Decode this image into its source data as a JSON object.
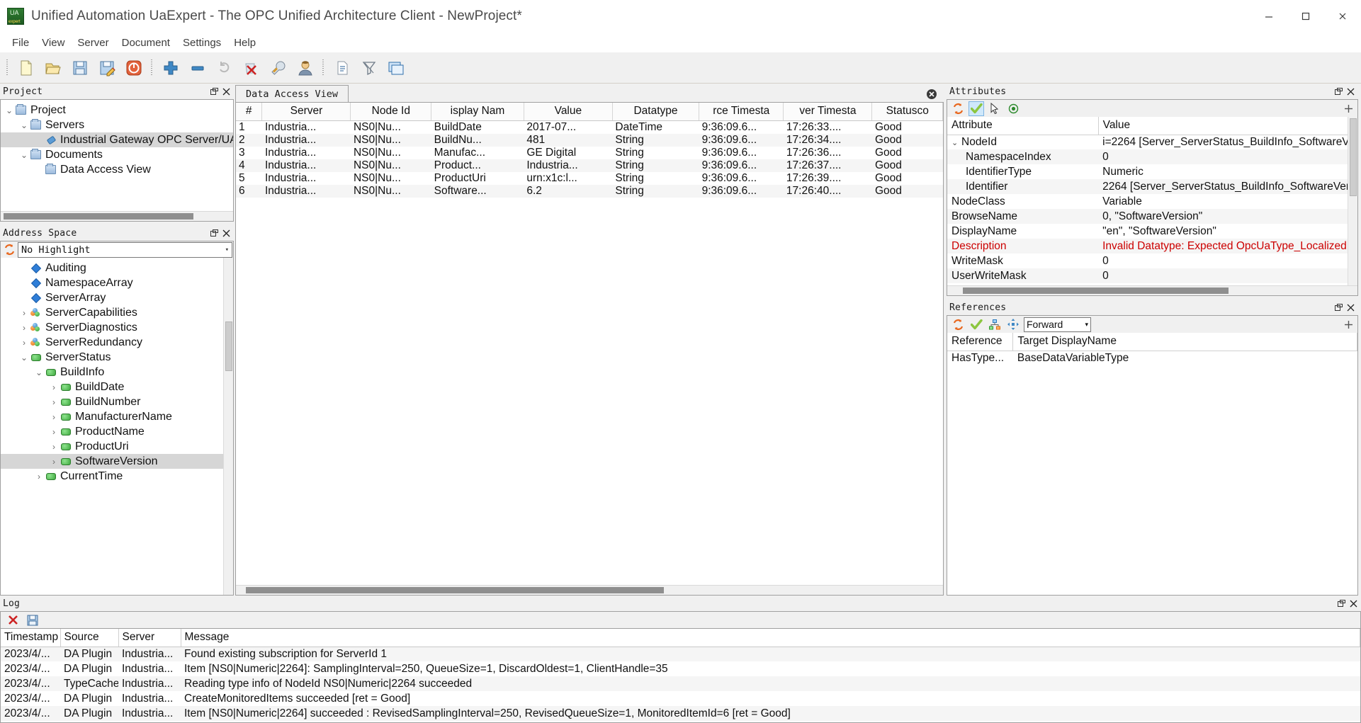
{
  "window": {
    "title": "Unified Automation UaExpert - The OPC Unified Architecture Client - NewProject*",
    "app_icon": "uaexpert-logo-icon",
    "minimize": "minimize-icon",
    "maximize": "maximize-icon",
    "close": "close-icon"
  },
  "menu": {
    "items": [
      "File",
      "View",
      "Server",
      "Document",
      "Settings",
      "Help"
    ]
  },
  "toolbar": {
    "groups": [
      [
        {
          "name": "new-project-icon",
          "tip": "New"
        },
        {
          "name": "open-project-icon",
          "tip": "Open"
        },
        {
          "name": "save-project-icon",
          "tip": "Save"
        },
        {
          "name": "save-as-project-icon",
          "tip": "Save As"
        },
        {
          "name": "disconnect-power-icon",
          "tip": "Disconnect"
        }
      ],
      [
        {
          "name": "add-server-icon",
          "tip": "Add Server"
        },
        {
          "name": "remove-server-icon",
          "tip": "Remove Server"
        },
        {
          "name": "reconnect-icon",
          "tip": "Reconnect"
        },
        {
          "name": "delete-red-x-icon",
          "tip": "Delete"
        },
        {
          "name": "configure-wrench-icon",
          "tip": "Configure"
        },
        {
          "name": "user-identity-icon",
          "tip": "User"
        }
      ],
      [
        {
          "name": "document-new-icon",
          "tip": "New Document"
        },
        {
          "name": "document-filter-icon",
          "tip": "Filter"
        },
        {
          "name": "window-tile-icon",
          "tip": "Windows"
        }
      ]
    ]
  },
  "project_panel": {
    "title": "Project",
    "float_btn": "float-icon",
    "close_btn": "close-icon",
    "tree": [
      {
        "label": "Project",
        "indent": 0,
        "twist": "expanded",
        "icon": "folder-icon",
        "selected": false
      },
      {
        "label": "Servers",
        "indent": 1,
        "twist": "expanded",
        "icon": "folder-icon",
        "selected": false
      },
      {
        "label": "Industrial Gateway OPC Server/UA@",
        "indent": 2,
        "twist": "none",
        "icon": "server-plug-icon",
        "selected": true
      },
      {
        "label": "Documents",
        "indent": 1,
        "twist": "expanded",
        "icon": "folder-icon",
        "selected": false
      },
      {
        "label": "Data Access View",
        "indent": 2,
        "twist": "none",
        "icon": "folder-icon",
        "selected": false
      }
    ]
  },
  "address_space_panel": {
    "title": "Address Space",
    "float_btn": "float-icon",
    "close_btn": "close-icon",
    "refresh_icon": "refresh-icon",
    "highlight_combo": {
      "value": "No Highlight",
      "arrow": "chevron-down-icon"
    },
    "tree": [
      {
        "label": "Auditing",
        "indent": 1,
        "twist": "none",
        "icon": "variable-diamond-icon",
        "selected": false
      },
      {
        "label": "NamespaceArray",
        "indent": 1,
        "twist": "none",
        "icon": "variable-diamond-icon",
        "selected": false
      },
      {
        "label": "ServerArray",
        "indent": 1,
        "twist": "none",
        "icon": "variable-diamond-icon",
        "selected": false
      },
      {
        "label": "ServerCapabilities",
        "indent": 1,
        "twist": "collapsed",
        "icon": "object-balls-icon",
        "selected": false
      },
      {
        "label": "ServerDiagnostics",
        "indent": 1,
        "twist": "collapsed",
        "icon": "object-balls-icon",
        "selected": false
      },
      {
        "label": "ServerRedundancy",
        "indent": 1,
        "twist": "collapsed",
        "icon": "object-balls-icon",
        "selected": false
      },
      {
        "label": "ServerStatus",
        "indent": 1,
        "twist": "expanded",
        "icon": "object-green-icon",
        "selected": false
      },
      {
        "label": "BuildInfo",
        "indent": 2,
        "twist": "expanded",
        "icon": "object-green-icon",
        "selected": false
      },
      {
        "label": "BuildDate",
        "indent": 3,
        "twist": "collapsed",
        "icon": "object-green-icon",
        "selected": false
      },
      {
        "label": "BuildNumber",
        "indent": 3,
        "twist": "collapsed",
        "icon": "object-green-icon",
        "selected": false
      },
      {
        "label": "ManufacturerName",
        "indent": 3,
        "twist": "collapsed",
        "icon": "object-green-icon",
        "selected": false
      },
      {
        "label": "ProductName",
        "indent": 3,
        "twist": "collapsed",
        "icon": "object-green-icon",
        "selected": false
      },
      {
        "label": "ProductUri",
        "indent": 3,
        "twist": "collapsed",
        "icon": "object-green-icon",
        "selected": false
      },
      {
        "label": "SoftwareVersion",
        "indent": 3,
        "twist": "collapsed",
        "icon": "object-green-icon",
        "selected": true
      },
      {
        "label": "CurrentTime",
        "indent": 2,
        "twist": "collapsed",
        "icon": "object-green-icon",
        "selected": false
      }
    ]
  },
  "document": {
    "tab_label": "Data Access View",
    "close_icon": "close-circle-icon",
    "grid": {
      "columns": [
        "#",
        "Server",
        "Node Id",
        "isplay Nam",
        "Value",
        "Datatype",
        "rce Timesta",
        "ver Timesta",
        "Statusco"
      ],
      "rows": [
        [
          "1",
          "Industria...",
          "NS0|Nu...",
          "BuildDate",
          "2017-07...",
          "DateTime",
          "9:36:09.6...",
          "17:26:33....",
          "Good"
        ],
        [
          "2",
          "Industria...",
          "NS0|Nu...",
          "BuildNu...",
          "481",
          "String",
          "9:36:09.6...",
          "17:26:34....",
          "Good"
        ],
        [
          "3",
          "Industria...",
          "NS0|Nu...",
          "Manufac...",
          "GE Digital",
          "String",
          "9:36:09.6...",
          "17:26:36....",
          "Good"
        ],
        [
          "4",
          "Industria...",
          "NS0|Nu...",
          "Product...",
          "Industria...",
          "String",
          "9:36:09.6...",
          "17:26:37....",
          "Good"
        ],
        [
          "5",
          "Industria...",
          "NS0|Nu...",
          "ProductUri",
          "urn:x1c:l...",
          "String",
          "9:36:09.6...",
          "17:26:39....",
          "Good"
        ],
        [
          "6",
          "Industria...",
          "NS0|Nu...",
          "Software...",
          "6.2",
          "String",
          "9:36:09.6...",
          "17:26:40....",
          "Good"
        ]
      ]
    }
  },
  "attributes_panel": {
    "title": "Attributes",
    "float_btn": "float-icon",
    "close_btn": "close-icon",
    "toolbar": [
      {
        "name": "refresh-icon",
        "active": false
      },
      {
        "name": "validate-check-icon",
        "active": true
      },
      {
        "name": "pick-cursor-icon",
        "active": false
      },
      {
        "name": "record-target-icon",
        "active": false
      }
    ],
    "plus_icon": "add-icon",
    "columns": [
      "Attribute",
      "Value"
    ],
    "rows": [
      {
        "attr": "NodeId",
        "value": "i=2264 [Server_ServerStatus_BuildInfo_SoftwareV",
        "indent": 0,
        "twist": "expanded",
        "error": false
      },
      {
        "attr": "NamespaceIndex",
        "value": "0",
        "indent": 1,
        "twist": "none",
        "error": false
      },
      {
        "attr": "IdentifierType",
        "value": "Numeric",
        "indent": 1,
        "twist": "none",
        "error": false
      },
      {
        "attr": "Identifier",
        "value": "2264 [Server_ServerStatus_BuildInfo_SoftwareVer",
        "indent": 1,
        "twist": "none",
        "error": false
      },
      {
        "attr": "NodeClass",
        "value": "Variable",
        "indent": 0,
        "twist": "none",
        "error": false
      },
      {
        "attr": "BrowseName",
        "value": "0, \"SoftwareVersion\"",
        "indent": 0,
        "twist": "none",
        "error": false
      },
      {
        "attr": "DisplayName",
        "value": "\"en\", \"SoftwareVersion\"",
        "indent": 0,
        "twist": "none",
        "error": false
      },
      {
        "attr": "Description",
        "value": "Invalid Datatype: Expected OpcUaType_Localized",
        "indent": 0,
        "twist": "none",
        "error": true
      },
      {
        "attr": "WriteMask",
        "value": "0",
        "indent": 0,
        "twist": "none",
        "error": false
      },
      {
        "attr": "UserWriteMask",
        "value": "0",
        "indent": 0,
        "twist": "none",
        "error": false
      }
    ]
  },
  "references_panel": {
    "title": "References",
    "float_btn": "float-icon",
    "close_btn": "close-icon",
    "toolbar": [
      {
        "name": "refresh-icon",
        "active": false
      },
      {
        "name": "validate-check-icon",
        "active": false
      },
      {
        "name": "hierarchy-icon",
        "active": false
      },
      {
        "name": "move-cross-icon",
        "active": false
      }
    ],
    "direction_combo": {
      "value": "Forward",
      "arrow": "chevron-down-icon"
    },
    "plus_icon": "add-icon",
    "columns": [
      "Reference",
      "Target DisplayName"
    ],
    "rows": [
      [
        "HasType...",
        "BaseDataVariableType"
      ]
    ]
  },
  "log_panel": {
    "title": "Log",
    "float_btn": "float-icon",
    "close_btn": "close-icon",
    "clear_icon": "clear-red-x-icon",
    "save_icon": "save-disk-icon",
    "columns": [
      "Timestamp",
      "Source",
      "Server",
      "Message"
    ],
    "rows": [
      [
        "2023/4/...",
        "DA Plugin",
        "Industria...",
        "Found existing subscription for ServerId 1"
      ],
      [
        "2023/4/...",
        "DA Plugin",
        "Industria...",
        "Item [NS0|Numeric|2264]: SamplingInterval=250, QueueSize=1, DiscardOldest=1, ClientHandle=35"
      ],
      [
        "2023/4/...",
        "TypeCache",
        "Industria...",
        "Reading type info of NodeId NS0|Numeric|2264 succeeded"
      ],
      [
        "2023/4/...",
        "DA Plugin",
        "Industria...",
        "CreateMonitoredItems succeeded [ret = Good]"
      ],
      [
        "2023/4/...",
        "DA Plugin",
        "Industria...",
        "Item [NS0|Numeric|2264] succeeded : RevisedSamplingInterval=250, RevisedQueueSize=1, MonitoredItemId=6 [ret = Good]"
      ]
    ]
  },
  "colors": {
    "accent_orange": "#e8661c",
    "error_red": "#cc0000",
    "selection_gray": "#d6d6d6",
    "panel_bg": "#f0f0f0",
    "active_toggle": "#cfe8fb"
  }
}
